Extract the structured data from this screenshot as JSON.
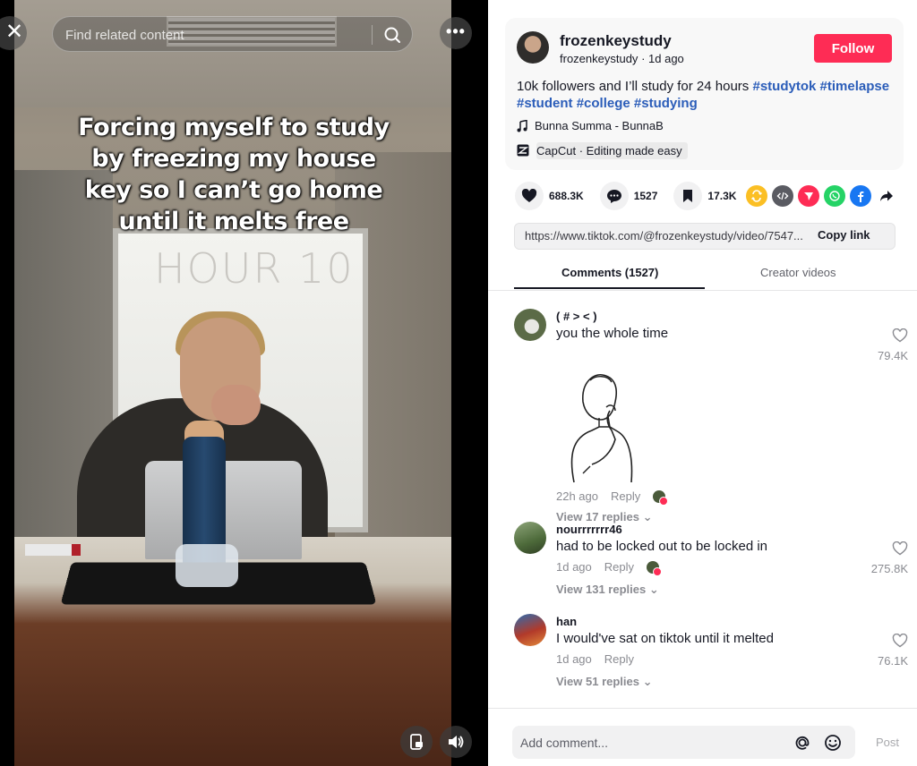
{
  "video": {
    "search_placeholder": "Find related content",
    "caption_lines": [
      "Forcing myself to study",
      "by freezing my house",
      "key so I can’t go home",
      "until it melts free"
    ],
    "whiteboard_text": "HOUR 10"
  },
  "post": {
    "username": "frozenkeystudy",
    "handle": "frozenkeystudy",
    "time_ago": "1d ago",
    "follow_label": "Follow",
    "description": "10k followers and I’ll study for 24 hours",
    "hashtags": [
      "#studytok",
      "#timelapse",
      "#student",
      "#college",
      "#studying"
    ],
    "music": "Bunna Summa - BunnaB",
    "capcut": "CapCut · Editing made easy"
  },
  "actions": {
    "likes": "688.3K",
    "comments": "1527",
    "saves": "17.3K"
  },
  "share_icons": [
    "repost-icon",
    "embed-icon",
    "send-icon",
    "whatsapp-icon",
    "facebook-icon",
    "share-arrow-icon"
  ],
  "link": {
    "url": "https://www.tiktok.com/@frozenkeystudy/video/7547...",
    "copy_label": "Copy link"
  },
  "tabs": {
    "comments_label": "Comments (1527)",
    "creator_label": "Creator videos"
  },
  "comments": [
    {
      "user": "( # > < )",
      "text": "you the whole time",
      "time": "22h ago",
      "reply": "Reply",
      "likes": "79.4K",
      "view_replies": "View 17 replies"
    },
    {
      "user": "nourrrrrrr46",
      "text": "had to be locked out to be locked in",
      "time": "1d ago",
      "reply": "Reply",
      "likes": "275.8K",
      "view_replies": "View 131 replies"
    },
    {
      "user": "han",
      "text": "I would've sat on tiktok until it melted",
      "time": "1d ago",
      "reply": "Reply",
      "likes": "76.1K",
      "view_replies": "View 51 replies"
    }
  ],
  "composer": {
    "placeholder": "Add comment...",
    "post_label": "Post"
  },
  "colors": {
    "brand": "#fe2c55",
    "hashtag": "#2b5db9"
  }
}
